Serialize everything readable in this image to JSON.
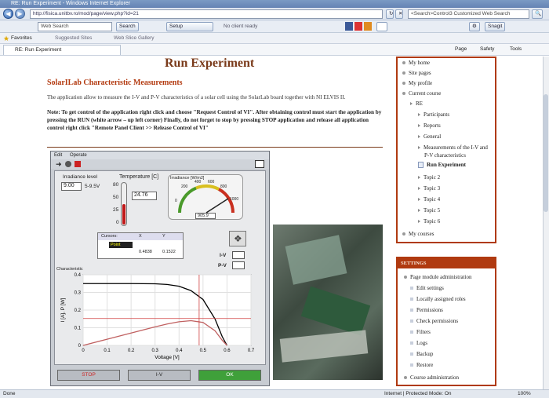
{
  "window": {
    "title": "RE: Run Experiment - Windows Internet Explorer"
  },
  "browser": {
    "address": "http://fisica.unitbv.ro/mod/page/view.php?id=21",
    "search_placeholder": "Web Search",
    "search_label": "Search",
    "setup_label": "Setup",
    "no_alerts": "No client ready",
    "bing_placeholder": "<Search>Control3 Customized Web Search",
    "snap_label": "Snagit",
    "favorites_label": "Favorites",
    "fav1": "Suggested Sites",
    "fav2": "Web Slice Gallery",
    "tab_label": "RE: Run Experiment",
    "page_menu": "Page",
    "safety_menu": "Safety",
    "tools_menu": "Tools"
  },
  "page": {
    "title": "Run Experiment",
    "heading": "SolarILab Characteristic Measurements",
    "description": "The application allow to measure the I-V and P-V characteristics of a solar cell using the SolarLab board together with NI ELVIS II.",
    "note": "Note: To get control of the application right click and choose \"Request Control of VI\". After obtaining control must start the application by pressing the RUN (white arrow – up left corner) Finally, do not forget to stop by pressing STOP application and release all application control right click \"Remote Panel Client >> Release Control of VI\""
  },
  "vi": {
    "menu_edit": "Edit",
    "menu_operate": "Operate",
    "irradiance_label": "Irradiance level",
    "irradiance_value": "9.00",
    "irradiance_range": "5-9.5V",
    "temperature_label": "Temperature [C]",
    "temperature_value": "24.76",
    "therm_ticks": [
      "80",
      "50",
      "25",
      "0"
    ],
    "gauge_label": "Irradiance [W/m2]",
    "gauge_ticks": [
      "0",
      "200",
      "400",
      "600",
      "800",
      "1000"
    ],
    "gauge_value": "905.9",
    "cursors_header": [
      "Cursors:",
      "X",
      "Y"
    ],
    "cursor_name": "Point",
    "cursor_x": "0.4838",
    "cursor_y": "0.1522",
    "iv_label": "I-V",
    "pv_label": "P-V",
    "chart_label": "Characteristic",
    "stop_label": "STOP",
    "pv_button": "I-V",
    "ok_label": "OK"
  },
  "chart_data": {
    "type": "line",
    "title": "Characteristic",
    "xlabel": "Voltage [V]",
    "ylabel": "I [A], P [W]",
    "xlim": [
      0,
      0.7
    ],
    "ylim": [
      0,
      0.4
    ],
    "x_ticks": [
      "0",
      "0.1",
      "0.2",
      "0.3",
      "0.4",
      "0.5",
      "0.6",
      "0.7"
    ],
    "y_ticks": [
      "0",
      "0.1",
      "0.2",
      "0.3",
      "0.4"
    ],
    "series": [
      {
        "x": [
          0,
          0.1,
          0.2,
          0.3,
          0.35,
          0.4,
          0.45,
          0.5,
          0.55,
          0.58,
          0.6
        ],
        "values": [
          0.35,
          0.35,
          0.35,
          0.349,
          0.345,
          0.335,
          0.31,
          0.26,
          0.15,
          0.05,
          0.0
        ],
        "color": "#000000"
      },
      {
        "x": [
          0,
          0.1,
          0.2,
          0.3,
          0.35,
          0.4,
          0.45,
          0.5,
          0.55,
          0.58,
          0.6
        ],
        "values": [
          0.0,
          0.035,
          0.07,
          0.105,
          0.121,
          0.134,
          0.14,
          0.13,
          0.083,
          0.029,
          0.0
        ],
        "color": "#c06060"
      }
    ],
    "cursor_x": 0.4838,
    "cursor_y": 0.1522
  },
  "sidebar": {
    "items": [
      {
        "label": "My home"
      },
      {
        "label": "Site pages"
      },
      {
        "label": "My profile"
      },
      {
        "label": "Current course"
      },
      {
        "label": "RE"
      },
      {
        "label": "Participants"
      },
      {
        "label": "Reports"
      },
      {
        "label": "General"
      },
      {
        "label": "Measurements of the I-V and"
      },
      {
        "label": "P-V characteristics"
      },
      {
        "label": "Run Experiment"
      },
      {
        "label": "Topic 2"
      },
      {
        "label": "Topic 3"
      },
      {
        "label": "Topic 4"
      },
      {
        "label": "Topic 5"
      },
      {
        "label": "Topic 6"
      },
      {
        "label": "My courses"
      }
    ]
  },
  "settings": {
    "header": "SETTINGS",
    "items": [
      {
        "label": "Page module administration"
      },
      {
        "label": "Edit settings"
      },
      {
        "label": "Locally assigned roles"
      },
      {
        "label": "Permissions"
      },
      {
        "label": "Check permissions"
      },
      {
        "label": "Filters"
      },
      {
        "label": "Logs"
      },
      {
        "label": "Backup"
      },
      {
        "label": "Restore"
      },
      {
        "label": "Course administration"
      }
    ]
  },
  "status": {
    "left": "Done",
    "zone": "Internet | Protected Mode: On",
    "zoom": "100%"
  },
  "colors": {
    "accent": "#b03a10",
    "title": "#7a3a1a"
  }
}
